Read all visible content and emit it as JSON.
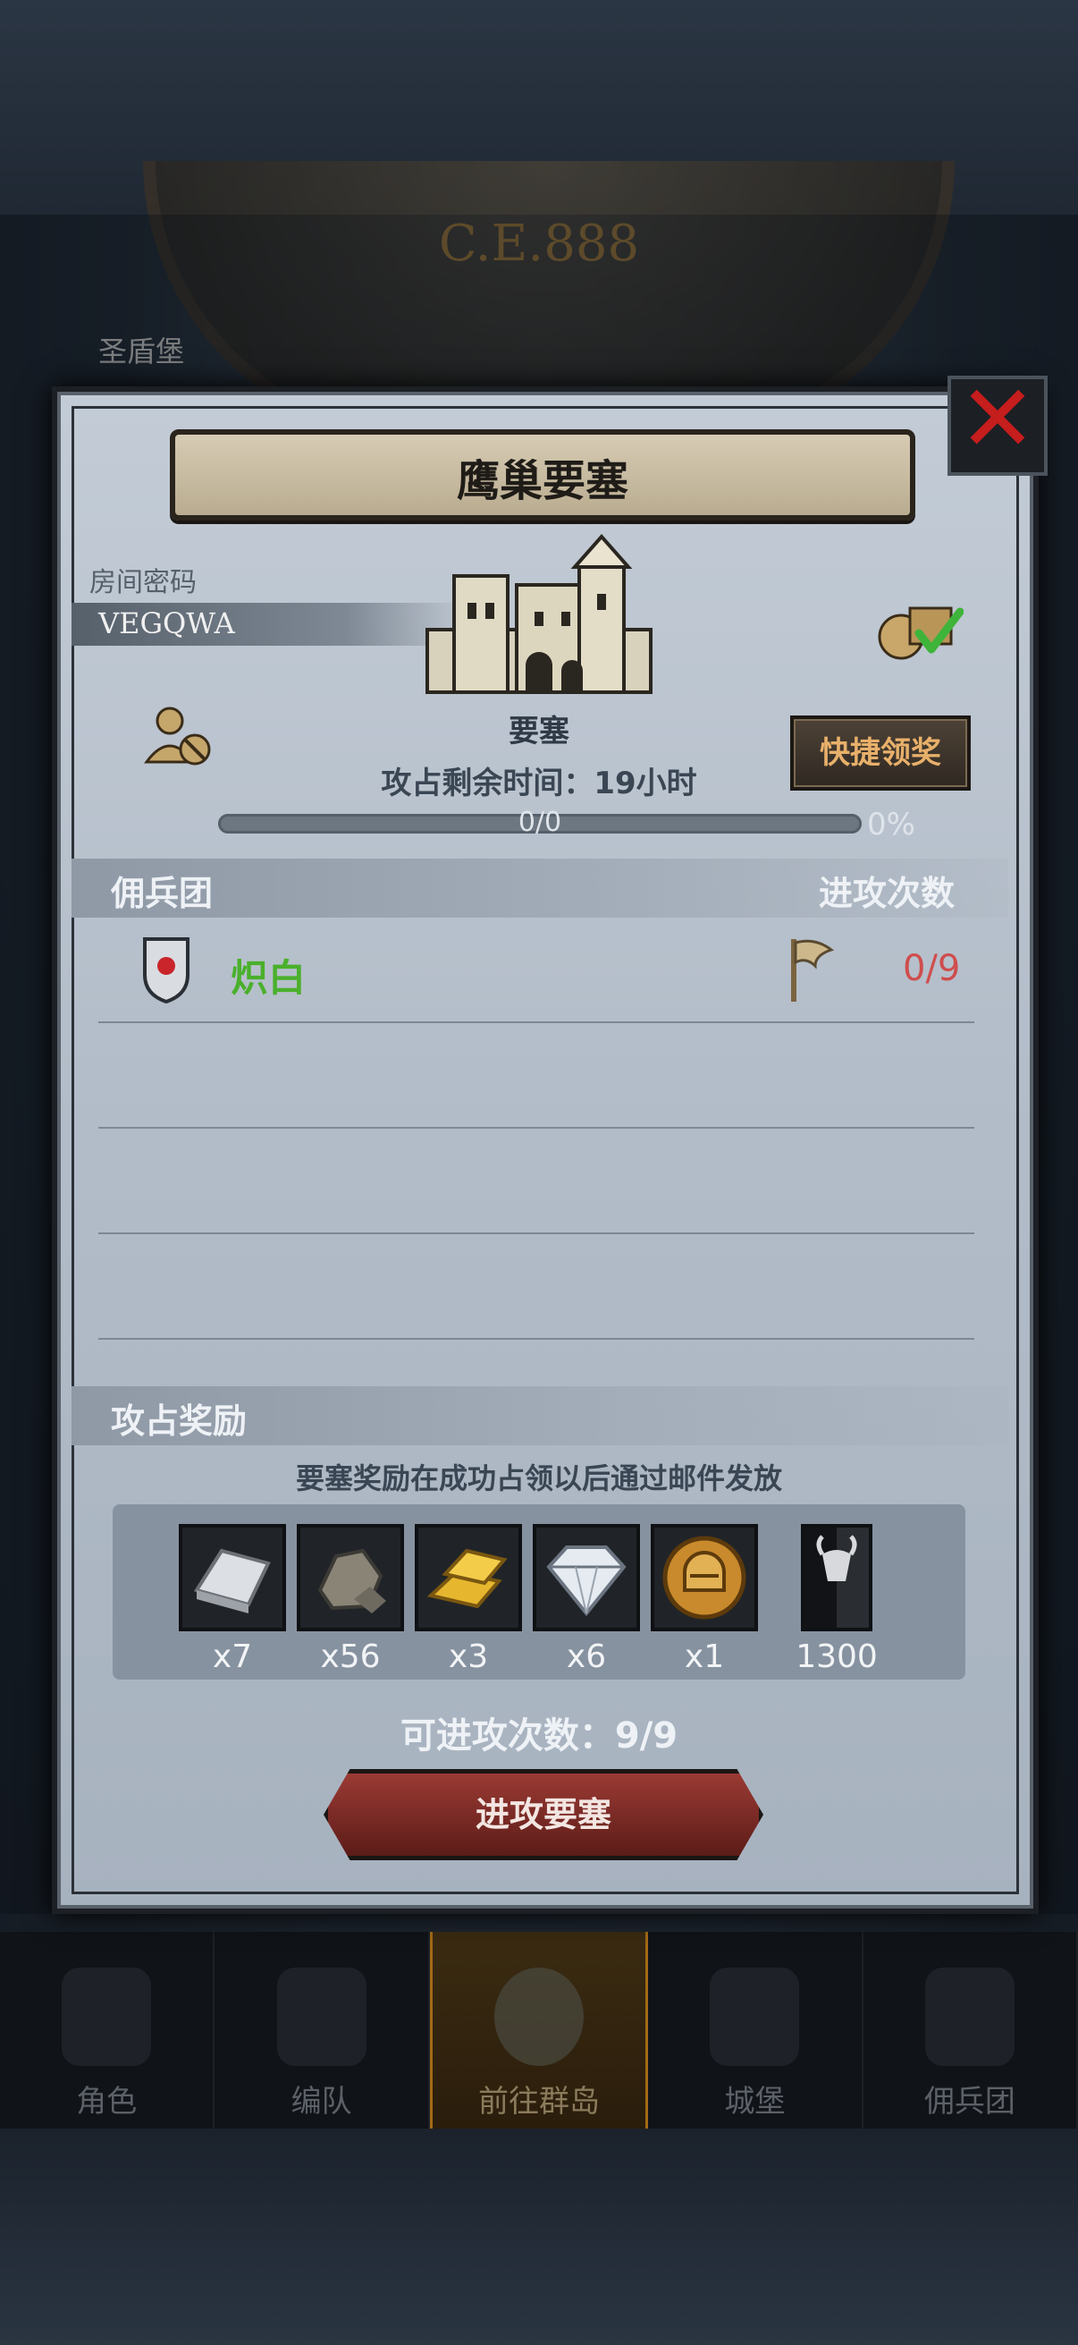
{
  "background": {
    "era_text": "C.E.888",
    "location_label": "圣盾堡"
  },
  "dialog": {
    "title": "鹰巢要塞",
    "room_password_label": "房间密码",
    "room_code": "VEGQWA",
    "fortress_label": "要塞",
    "time_remaining": "攻占剩余时间：19小时",
    "quick_claim_label": "快捷领奖",
    "progress": {
      "text": "0/0",
      "percent_label": "0%",
      "fraction": 0
    },
    "mercenary_section": {
      "title": "佣兵团",
      "attack_header": "进攻次数",
      "rows": [
        {
          "name": "炽白",
          "attacks": "0/9"
        }
      ]
    },
    "reward_section": {
      "title": "攻占奖励",
      "note": "要塞奖励在成功占领以后通过邮件发放",
      "items": [
        {
          "icon": "silver-ingot-icon",
          "qty": "x7"
        },
        {
          "icon": "stone-ore-icon",
          "qty": "x56"
        },
        {
          "icon": "gold-bars-icon",
          "qty": "x3"
        },
        {
          "icon": "diamond-icon",
          "qty": "x6"
        },
        {
          "icon": "helmet-medal-icon",
          "qty": "x1"
        },
        {
          "icon": "horned-banner-icon",
          "qty": "1300"
        }
      ]
    },
    "attempts_text": "可进攻次数：9/9",
    "attack_button_label": "进攻要塞",
    "close_icon": "close-icon"
  },
  "nav": {
    "items": [
      {
        "label": "角色"
      },
      {
        "label": "编队"
      },
      {
        "label": "前往群岛",
        "active": true
      },
      {
        "label": "城堡"
      },
      {
        "label": "佣兵团"
      }
    ]
  },
  "colors": {
    "green_name": "#4ab02b",
    "red_count": "#cf4d4d",
    "quick_btn_text": "#e8b06a",
    "close_x": "#c61d1d"
  }
}
